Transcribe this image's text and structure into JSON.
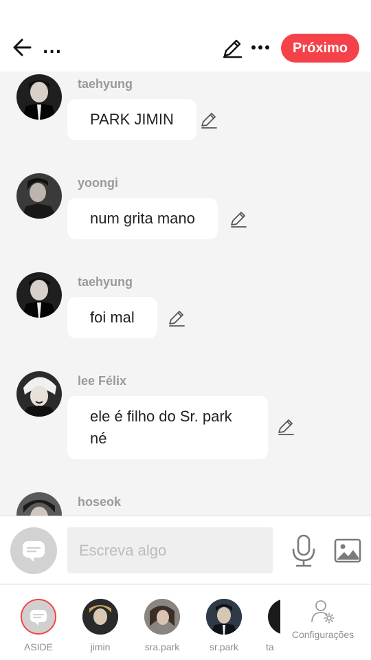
{
  "header": {
    "title": "...",
    "next_label": "Próximo",
    "accent": "#f5424a"
  },
  "messages": [
    {
      "author": "taehyung",
      "text": "PARK JIMIN",
      "avatar": "taehyung-avatar"
    },
    {
      "author": "yoongi",
      "text": "num grita mano",
      "avatar": "yoongi-avatar"
    },
    {
      "author": "taehyung",
      "text": "foi mal",
      "avatar": "taehyung-avatar"
    },
    {
      "author": "lee Félix",
      "text": "ele é filho do Sr. park né",
      "avatar": "lee-felix-avatar"
    },
    {
      "author": "hoseok",
      "text": "",
      "avatar": "hoseok-avatar"
    }
  ],
  "composer": {
    "placeholder": "Escreva algo"
  },
  "characters": [
    {
      "label": "ASIDE",
      "selected": true
    },
    {
      "label": "jimin"
    },
    {
      "label": "sra.park"
    },
    {
      "label": "sr.park"
    },
    {
      "label": "ta"
    }
  ],
  "settings": {
    "label": "Configurações"
  }
}
